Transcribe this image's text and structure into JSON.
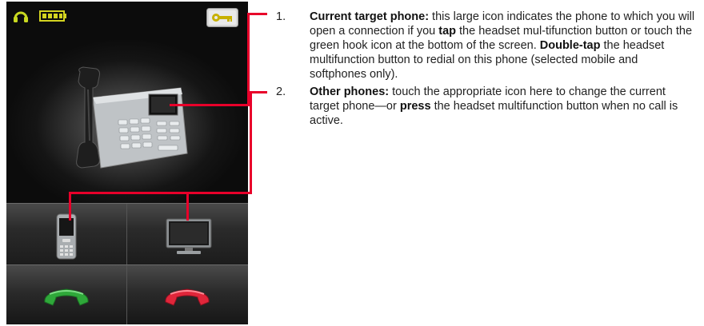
{
  "device": {
    "status_icons": [
      "headset-icon",
      "battery-icon"
    ],
    "settings_icon": "key-icon",
    "current_phone_icon": "desk-phone-icon",
    "other_phones": [
      "mobile-phone-icon",
      "softphone-icon"
    ],
    "call_buttons": [
      "green-hook-icon",
      "red-hook-icon"
    ],
    "colors": {
      "accent_red": "#e8002a",
      "hook_green": "#2fa83a",
      "hook_red": "#e0263a"
    }
  },
  "descriptions": [
    {
      "number": "1.",
      "parts": [
        {
          "bold": true,
          "text": "Current target phone:"
        },
        {
          "bold": false,
          "text": " this large icon indicates the phone to which you will open a connection if you "
        },
        {
          "bold": true,
          "text": "tap"
        },
        {
          "bold": false,
          "text": " the headset mul-tifunction button or touch the green hook icon at the bottom of the screen. "
        },
        {
          "bold": true,
          "text": "Double-tap"
        },
        {
          "bold": false,
          "text": " the headset multifunction button to redial on this phone (selected mobile and softphones only)."
        }
      ]
    },
    {
      "number": "2.",
      "parts": [
        {
          "bold": true,
          "text": "Other phones:"
        },
        {
          "bold": false,
          "text": " touch the appropriate icon here to change the current target phone—or "
        },
        {
          "bold": true,
          "text": "press"
        },
        {
          "bold": false,
          "text": " the headset multifunction button when no call is active."
        }
      ]
    }
  ]
}
